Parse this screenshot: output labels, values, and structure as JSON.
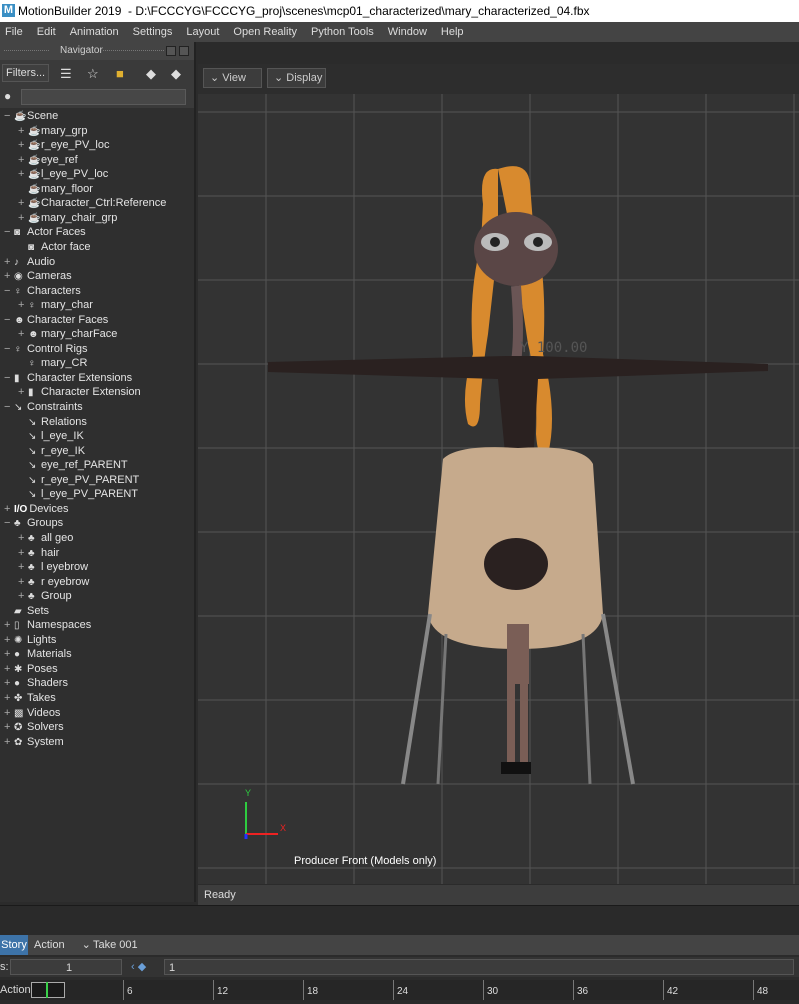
{
  "window": {
    "app_title": "MotionBuilder 2019",
    "file_path": "- D:\\FCCCYG\\FCCCYG_proj\\scenes\\mcp01_characterized\\mary_characterized_04.fbx",
    "logo": "M"
  },
  "menu": [
    "File",
    "Edit",
    "Animation",
    "Settings",
    "Layout",
    "Open Reality",
    "Python Tools",
    "Window",
    "Help"
  ],
  "navigator": {
    "title": "Navigator",
    "filters_label": "Filters...",
    "search_value": ""
  },
  "tree": [
    {
      "label": "Scene",
      "depth": 0,
      "toggle": "−",
      "icon": "teapot-icon"
    },
    {
      "label": "mary_grp",
      "depth": 1,
      "toggle": "+",
      "icon": "teapot-icon"
    },
    {
      "label": "r_eye_PV_loc",
      "depth": 1,
      "toggle": "+",
      "icon": "teapot-icon"
    },
    {
      "label": "eye_ref",
      "depth": 1,
      "toggle": "+",
      "icon": "teapot-icon"
    },
    {
      "label": "l_eye_PV_loc",
      "depth": 1,
      "toggle": "+",
      "icon": "teapot-icon"
    },
    {
      "label": "mary_floor",
      "depth": 1,
      "toggle": "",
      "icon": "teapot-icon"
    },
    {
      "label": "Character_Ctrl:Reference",
      "depth": 1,
      "toggle": "+",
      "icon": "teapot-icon"
    },
    {
      "label": "mary_chair_grp",
      "depth": 1,
      "toggle": "+",
      "icon": "teapot-icon"
    },
    {
      "label": "Actor Faces",
      "depth": 0,
      "toggle": "−",
      "icon": "mask-icon"
    },
    {
      "label": "Actor face",
      "depth": 1,
      "toggle": "",
      "icon": "mask-icon"
    },
    {
      "label": "Audio",
      "depth": 0,
      "toggle": "+",
      "icon": "speaker-icon"
    },
    {
      "label": "Cameras",
      "depth": 0,
      "toggle": "+",
      "icon": "camera-icon"
    },
    {
      "label": "Characters",
      "depth": 0,
      "toggle": "−",
      "icon": "character-icon"
    },
    {
      "label": "mary_char",
      "depth": 1,
      "toggle": "+",
      "icon": "character-icon"
    },
    {
      "label": "Character Faces",
      "depth": 0,
      "toggle": "−",
      "icon": "face-icon"
    },
    {
      "label": "mary_charFace",
      "depth": 1,
      "toggle": "+",
      "icon": "face-icon"
    },
    {
      "label": "Control Rigs",
      "depth": 0,
      "toggle": "−",
      "icon": "rig-icon"
    },
    {
      "label": "mary_CR",
      "depth": 1,
      "toggle": "",
      "icon": "rig-icon"
    },
    {
      "label": "Character Extensions",
      "depth": 0,
      "toggle": "−",
      "icon": "extension-icon"
    },
    {
      "label": "Character Extension",
      "depth": 1,
      "toggle": "+",
      "icon": "extension-icon"
    },
    {
      "label": "Constraints",
      "depth": 0,
      "toggle": "−",
      "icon": "constraint-icon"
    },
    {
      "label": "Relations",
      "depth": 1,
      "toggle": "",
      "icon": "constraint-icon"
    },
    {
      "label": "l_eye_IK",
      "depth": 1,
      "toggle": "",
      "icon": "constraint-icon"
    },
    {
      "label": "r_eye_IK",
      "depth": 1,
      "toggle": "",
      "icon": "constraint-icon"
    },
    {
      "label": "eye_ref_PARENT",
      "depth": 1,
      "toggle": "",
      "icon": "constraint-icon"
    },
    {
      "label": "r_eye_PV_PARENT",
      "depth": 1,
      "toggle": "",
      "icon": "constraint-icon"
    },
    {
      "label": "l_eye_PV_PARENT",
      "depth": 1,
      "toggle": "",
      "icon": "constraint-icon"
    },
    {
      "label": "Devices",
      "depth": 0,
      "toggle": "+",
      "icon": "io-icon",
      "prefix": "I/O"
    },
    {
      "label": "Groups",
      "depth": 0,
      "toggle": "−",
      "icon": "group-icon"
    },
    {
      "label": "all geo",
      "depth": 1,
      "toggle": "+",
      "icon": "group-icon"
    },
    {
      "label": "hair",
      "depth": 1,
      "toggle": "+",
      "icon": "group-icon"
    },
    {
      "label": "l eyebrow",
      "depth": 1,
      "toggle": "+",
      "icon": "group-icon"
    },
    {
      "label": "r eyebrow",
      "depth": 1,
      "toggle": "+",
      "icon": "group-icon"
    },
    {
      "label": "Group",
      "depth": 1,
      "toggle": "+",
      "icon": "group-icon"
    },
    {
      "label": "Sets",
      "depth": 0,
      "toggle": "",
      "icon": "folder-icon"
    },
    {
      "label": "Namespaces",
      "depth": 0,
      "toggle": "+",
      "icon": "namespace-icon"
    },
    {
      "label": "Lights",
      "depth": 0,
      "toggle": "+",
      "icon": "light-icon"
    },
    {
      "label": "Materials",
      "depth": 0,
      "toggle": "+",
      "icon": "material-icon"
    },
    {
      "label": "Poses",
      "depth": 0,
      "toggle": "+",
      "icon": "pose-icon"
    },
    {
      "label": "Shaders",
      "depth": 0,
      "toggle": "+",
      "icon": "shader-icon"
    },
    {
      "label": "Takes",
      "depth": 0,
      "toggle": "+",
      "icon": "take-icon"
    },
    {
      "label": "Videos",
      "depth": 0,
      "toggle": "+",
      "icon": "video-icon"
    },
    {
      "label": "Solvers",
      "depth": 0,
      "toggle": "+",
      "icon": "solver-icon"
    },
    {
      "label": "System",
      "depth": 0,
      "toggle": "+",
      "icon": "system-icon"
    }
  ],
  "viewport": {
    "view_label": "View",
    "display_label": "Display",
    "camera_label": "Producer Front (Models only)",
    "coord_readout": "Y 100.00",
    "axis_y": "Y",
    "axis_x": "X"
  },
  "status": {
    "text": "Ready"
  },
  "story": {
    "tab_label": "Story",
    "action_label": "Action",
    "take_label": "Take 001"
  },
  "frames": {
    "label": "s:",
    "start": "1",
    "current": "1"
  },
  "timeline": {
    "action_label": "Action",
    "ticks": [
      "6",
      "12",
      "18",
      "24",
      "30",
      "36",
      "42",
      "48"
    ]
  },
  "colors": {
    "viewport_bg": "#333333",
    "grid": "#555555",
    "accent_blue": "#3d73a8",
    "hair": "#d88a2e",
    "chair": "#c6aa8c"
  }
}
